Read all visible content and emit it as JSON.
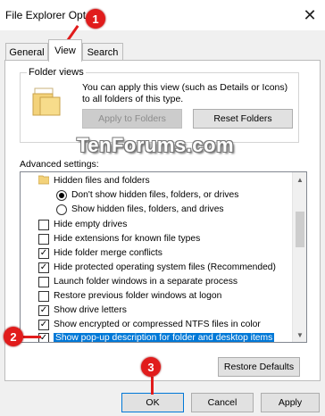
{
  "window": {
    "title": "File Explorer Opt"
  },
  "tabs": [
    {
      "label": "General"
    },
    {
      "label": "View"
    },
    {
      "label": "Search"
    }
  ],
  "folder_views": {
    "group_label": "Folder views",
    "description": "You can apply this view (such as Details or Icons) to all folders of this type.",
    "apply_label": "Apply to Folders",
    "reset_label": "Reset Folders"
  },
  "watermark": "TenForums.com",
  "advanced": {
    "label": "Advanced settings:",
    "items": [
      {
        "type": "folder",
        "label": "Hidden files and folders"
      },
      {
        "type": "radio",
        "checked": true,
        "label": "Don't show hidden files, folders, or drives"
      },
      {
        "type": "radio",
        "checked": false,
        "label": "Show hidden files, folders, and drives"
      },
      {
        "type": "checkbox",
        "checked": false,
        "label": "Hide empty drives"
      },
      {
        "type": "checkbox",
        "checked": false,
        "label": "Hide extensions for known file types"
      },
      {
        "type": "checkbox",
        "checked": true,
        "label": "Hide folder merge conflicts"
      },
      {
        "type": "checkbox",
        "checked": true,
        "label": "Hide protected operating system files (Recommended)"
      },
      {
        "type": "checkbox",
        "checked": false,
        "label": "Launch folder windows in a separate process"
      },
      {
        "type": "checkbox",
        "checked": false,
        "label": "Restore previous folder windows at logon"
      },
      {
        "type": "checkbox",
        "checked": true,
        "label": "Show drive letters"
      },
      {
        "type": "checkbox",
        "checked": true,
        "label": "Show encrypted or compressed NTFS files in color"
      },
      {
        "type": "checkbox",
        "checked": true,
        "selected": true,
        "label": "Show pop-up description for folder and desktop items"
      }
    ]
  },
  "buttons": {
    "restore_defaults": "Restore Defaults",
    "ok": "OK",
    "cancel": "Cancel",
    "apply": "Apply"
  },
  "callouts": [
    "1",
    "2",
    "3"
  ],
  "colors": {
    "accent": "#0078d7",
    "callout": "#e11c1c"
  }
}
